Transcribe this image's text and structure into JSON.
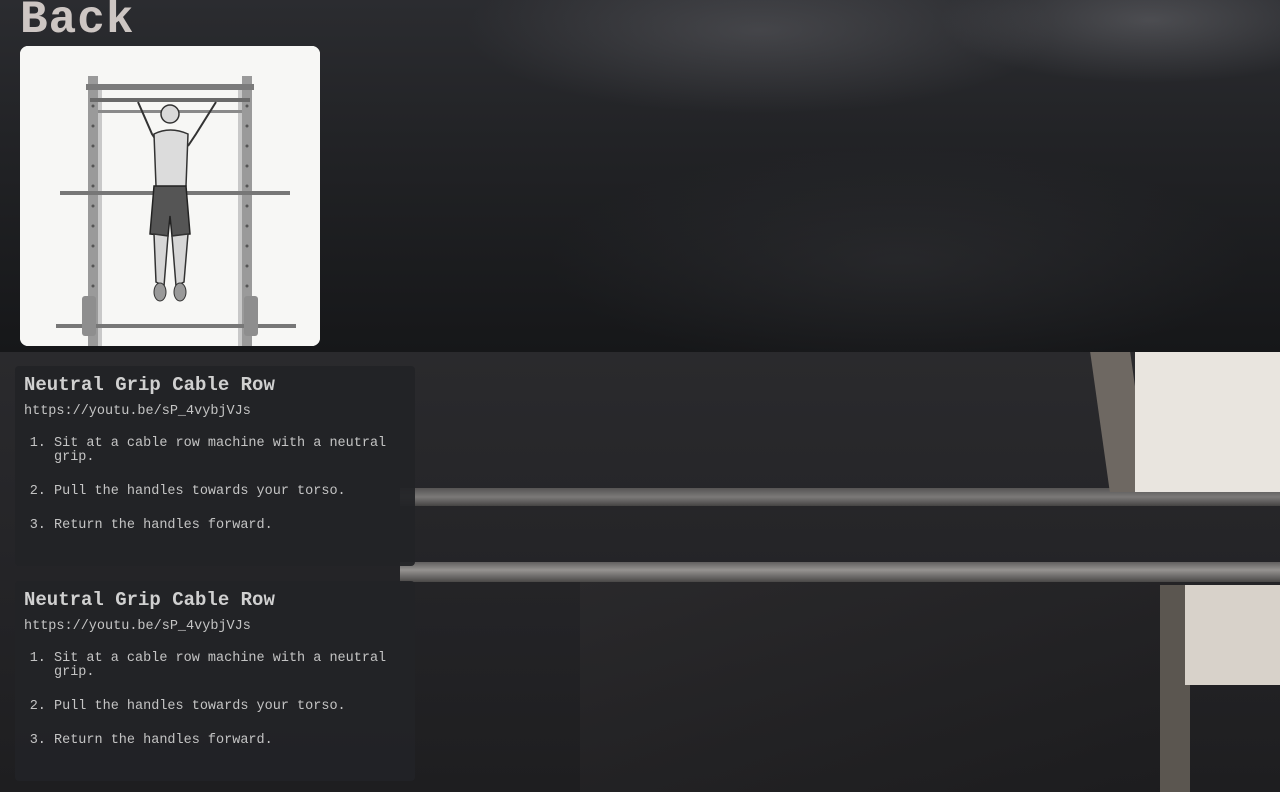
{
  "nav": {
    "back_label": "Back"
  },
  "hero": {
    "alt": "Illustration of a man hanging from a pull-up bar in a power rack"
  },
  "exercises": [
    {
      "title": "Neutral Grip Cable Row",
      "url": "https://youtu.be/sP_4vybjVJs",
      "steps": [
        "Sit at a cable row machine with a neutral grip.",
        "Pull the handles towards your torso.",
        "Return the handles forward."
      ]
    },
    {
      "title": "Neutral Grip Cable Row",
      "url": "https://youtu.be/sP_4vybjVJs",
      "steps": [
        "Sit at a cable row machine with a neutral grip.",
        "Pull the handles towards your torso.",
        "Return the handles forward."
      ]
    }
  ],
  "colors": {
    "text": "#c4c4c4",
    "card_bg": "#222326",
    "back": "#cdc6c3"
  }
}
